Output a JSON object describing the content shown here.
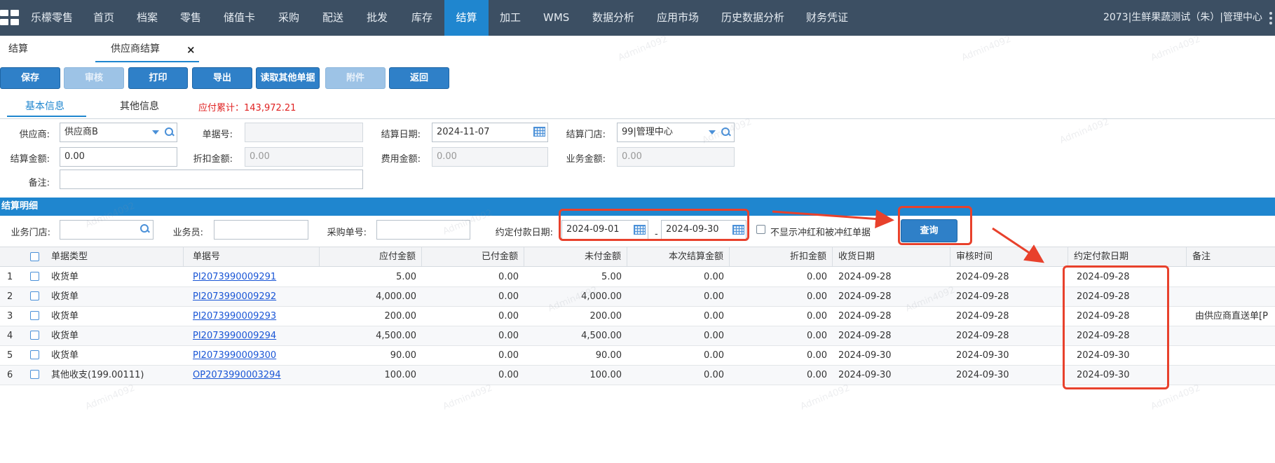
{
  "topnav": {
    "items": [
      "乐檬零售",
      "首页",
      "档案",
      "零售",
      "储值卡",
      "采购",
      "配送",
      "批发",
      "库存",
      "结算",
      "加工",
      "WMS",
      "数据分析",
      "应用市场",
      "历史数据分析",
      "财务凭证"
    ],
    "active": "结算",
    "user_info": "2073|生鲜果蔬测试（朱）|管理中心"
  },
  "tabs": {
    "first": "结算",
    "second": "供应商结算",
    "close": "×"
  },
  "toolbar": {
    "save": "保存",
    "audit": "审核",
    "print": "打印",
    "export": "导出",
    "read_other": "读取其他单据",
    "attachment": "附件",
    "back": "返回"
  },
  "info_tabs": {
    "basic": "基本信息",
    "other": "其他信息",
    "payable": "应付累计：143,972.21"
  },
  "form": {
    "supplier_label": "供应商:",
    "supplier_value": "供应商B",
    "doc_no_label": "单据号:",
    "doc_no_value": "",
    "settle_date_label": "结算日期:",
    "settle_date_value": "2024-11-07",
    "settle_store_label": "结算门店:",
    "settle_store_value": "99|管理中心",
    "settle_amount_label": "结算金额:",
    "settle_amount_value": "0.00",
    "discount_label": "折扣金额:",
    "discount_value": "0.00",
    "fee_label": "费用金额:",
    "fee_value": "0.00",
    "business_label": "业务金额:",
    "business_value": "0.00",
    "remark_label": "备注:",
    "remark_value": ""
  },
  "detail": {
    "title": "结算明细",
    "filter": {
      "store_label": "业务门店:",
      "store_value": "",
      "staff_label": "业务员:",
      "staff_value": "",
      "po_label": "采购单号:",
      "po_value": "",
      "pay_date_label": "约定付款日期:",
      "date_from": "2024-09-01",
      "date_sep": "-",
      "date_to": "2024-09-30",
      "hide_red_label": "不显示冲红和被冲红单据",
      "query_button": "查询"
    }
  },
  "table": {
    "columns": [
      "单据类型",
      "单据号",
      "应付金额",
      "已付金额",
      "未付金额",
      "本次结算金额",
      "折扣金额",
      "收货日期",
      "审核时间",
      "约定付款日期",
      "备注"
    ],
    "rows": [
      {
        "idx": "1",
        "type": "收货单",
        "no": "PI2073990009291",
        "payable": "5.00",
        "paid": "0.00",
        "unpaid": "5.00",
        "current": "0.00",
        "discount": "0.00",
        "receive_date": "2024-09-28",
        "audit_time": "2024-09-28",
        "pay_date": "2024-09-28",
        "remark": ""
      },
      {
        "idx": "2",
        "type": "收货单",
        "no": "PI2073990009292",
        "payable": "4,000.00",
        "paid": "0.00",
        "unpaid": "4,000.00",
        "current": "0.00",
        "discount": "0.00",
        "receive_date": "2024-09-28",
        "audit_time": "2024-09-28",
        "pay_date": "2024-09-28",
        "remark": ""
      },
      {
        "idx": "3",
        "type": "收货单",
        "no": "PI2073990009293",
        "payable": "200.00",
        "paid": "0.00",
        "unpaid": "200.00",
        "current": "0.00",
        "discount": "0.00",
        "receive_date": "2024-09-28",
        "audit_time": "2024-09-28",
        "pay_date": "2024-09-28",
        "remark": "由供应商直送单[P"
      },
      {
        "idx": "4",
        "type": "收货单",
        "no": "PI2073990009294",
        "payable": "4,500.00",
        "paid": "0.00",
        "unpaid": "4,500.00",
        "current": "0.00",
        "discount": "0.00",
        "receive_date": "2024-09-28",
        "audit_time": "2024-09-28",
        "pay_date": "2024-09-28",
        "remark": ""
      },
      {
        "idx": "5",
        "type": "收货单",
        "no": "PI2073990009300",
        "payable": "90.00",
        "paid": "0.00",
        "unpaid": "90.00",
        "current": "0.00",
        "discount": "0.00",
        "receive_date": "2024-09-30",
        "audit_time": "2024-09-30",
        "pay_date": "2024-09-30",
        "remark": ""
      },
      {
        "idx": "6",
        "type": "其他收支(199.00111)",
        "no": "OP2073990003294",
        "payable": "100.00",
        "paid": "0.00",
        "unpaid": "100.00",
        "current": "0.00",
        "discount": "0.00",
        "receive_date": "2024-09-30",
        "audit_time": "2024-09-30",
        "pay_date": "2024-09-30",
        "remark": ""
      }
    ]
  },
  "watermark": "Admin4092",
  "colors": {
    "nav_bg": "#3c4f63",
    "accent": "#1f86cf",
    "button": "#2f80c8",
    "annotation": "#e8412c",
    "payable_text": "#e02222",
    "link": "#1a56d6"
  },
  "icons": [
    "grid-logo-icon",
    "more-vertical-icon",
    "close-icon",
    "search-icon",
    "dropdown-arrow-icon",
    "calendar-icon",
    "checkbox-icon"
  ]
}
